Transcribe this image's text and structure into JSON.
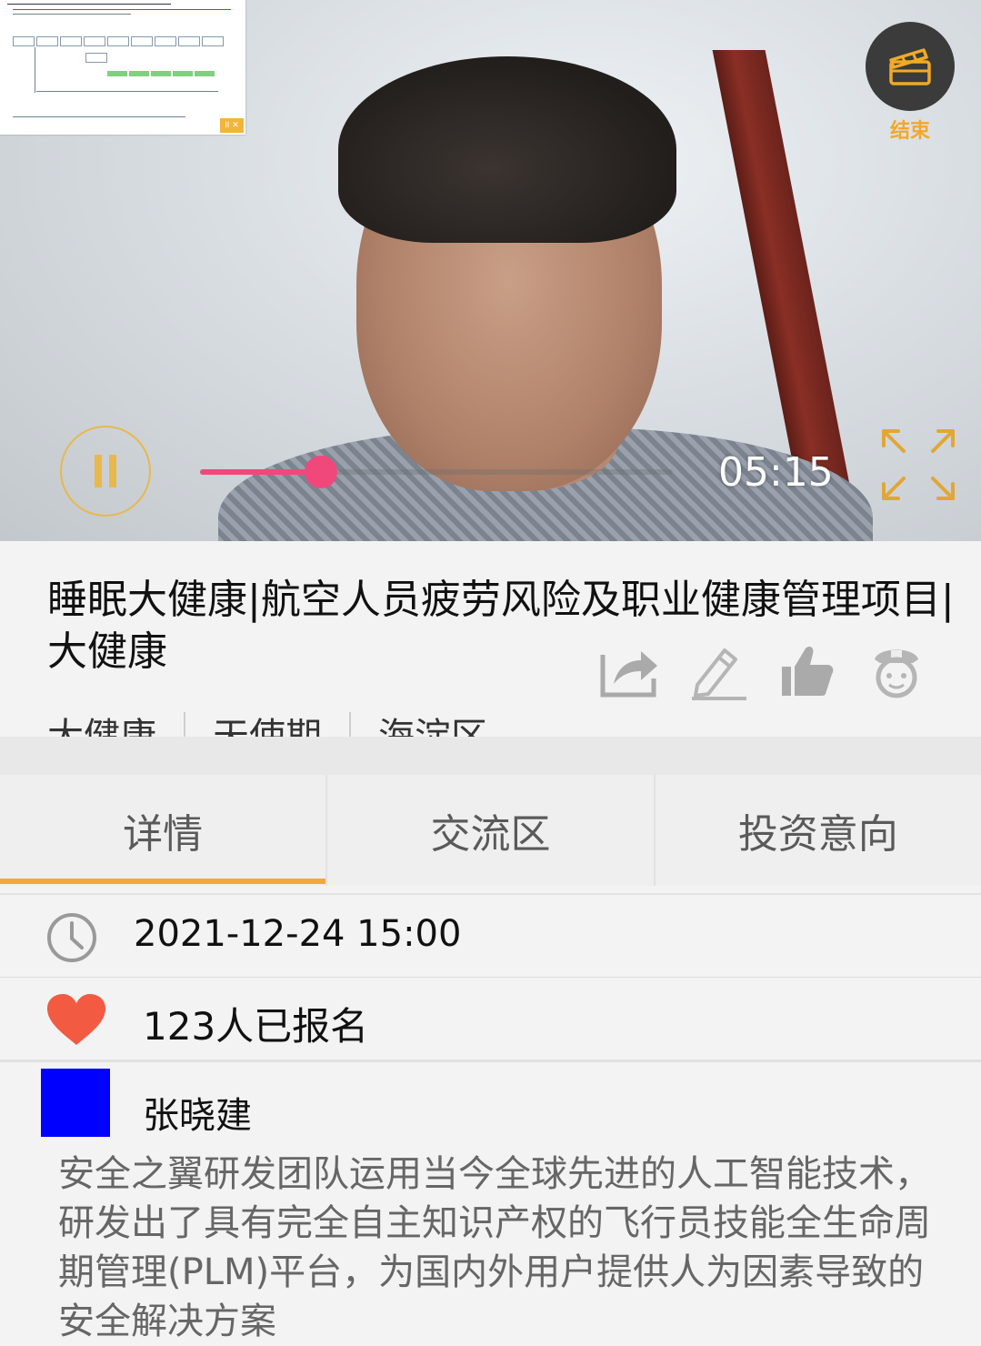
{
  "video": {
    "end_label": "结束",
    "time": "05:15",
    "progress": 0.255,
    "colors": {
      "accent": "#f0a92a",
      "progress": "#f0487a"
    },
    "pip": {
      "badge_text": "II ✕"
    },
    "icons": [
      "clapperboard-icon",
      "pause-icon",
      "fullscreen-icon"
    ]
  },
  "event": {
    "title": "睡眠大健康|航空人员疲劳风险及职业健康管理项目|大健康",
    "tags": [
      "大健康",
      "天使期",
      "海淀区"
    ]
  },
  "actions": [
    {
      "name": "share-icon"
    },
    {
      "name": "edit-icon"
    },
    {
      "name": "like-icon"
    },
    {
      "name": "officer-icon"
    }
  ],
  "tabs": [
    {
      "label": "详情",
      "active": true
    },
    {
      "label": "交流区",
      "active": false
    },
    {
      "label": "投资意向",
      "active": false
    }
  ],
  "info": {
    "datetime": "2021-12-24 15:00",
    "signup": "123人已报名"
  },
  "speaker": {
    "name": "张晓建",
    "avatar_color": "#0000ff",
    "description": "安全之翼研发团队运用当今全球先进的人工智能技术，研发出了具有完全自主知识产权的飞行员技能全生命周期管理(PLM)平台，为国内外用户提供人为因素导致的安全解决方案"
  }
}
